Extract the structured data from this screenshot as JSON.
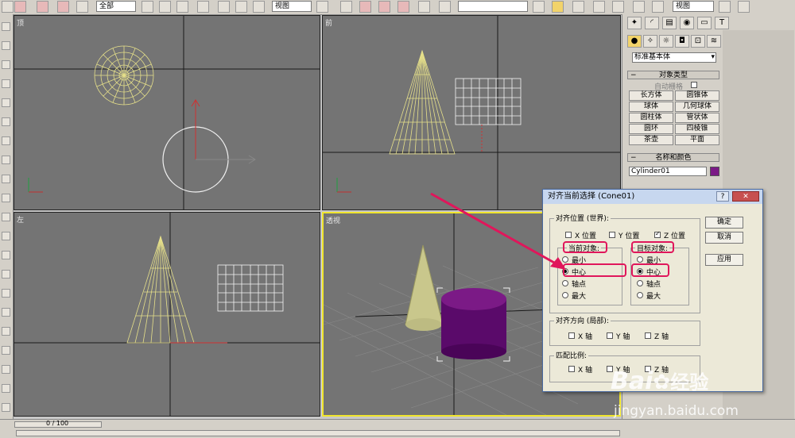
{
  "toolbar": {
    "selection_filter": "全部",
    "coord_system_1": "视图",
    "named_selection": "",
    "coord_system_2": "视图"
  },
  "viewports": {
    "top": "顶",
    "front": "前",
    "left": "左",
    "perspective": "透视"
  },
  "command_panel": {
    "category": "标准基本体",
    "object_type_header": "对象类型",
    "autogrid_label": "自动栅格",
    "buttons": [
      "长方体",
      "圆锥体",
      "球体",
      "几何球体",
      "圆柱体",
      "管状体",
      "圆环",
      "四棱锥",
      "茶壶",
      "平面"
    ],
    "name_color_header": "名称和颜色",
    "object_name": "Cylinder01",
    "object_color": "#7b1a86"
  },
  "timeline": {
    "frame_display": "0 / 100"
  },
  "dialog": {
    "title": "对齐当前选择 (Cone01)",
    "help_button": "?",
    "close_button": "✕",
    "align_position_group": "对齐位置 (世界):",
    "x_position": "X 位置",
    "y_position": "Y 位置",
    "z_position": "Z 位置",
    "x_checked": false,
    "y_checked": false,
    "z_checked": true,
    "current_object_group": "当前对象:",
    "target_object_group": "目标对象:",
    "options": [
      "最小",
      "中心",
      "轴点",
      "最大"
    ],
    "current_selected": "中心",
    "target_selected": "中心",
    "align_orientation_group": "对齐方向 (局部):",
    "orient_x": "X 轴",
    "orient_y": "Y 轴",
    "orient_z": "Z 轴",
    "match_scale_group": "匹配比例:",
    "scale_x": "X 轴",
    "scale_y": "Y 轴",
    "scale_z": "Z 轴",
    "ok_button": "确定",
    "cancel_button": "取消",
    "apply_button": "应用"
  },
  "watermark": {
    "brand": "Bai",
    "brand_suffix": "经验",
    "url": "jingyan.baidu.com"
  },
  "colors": {
    "highlight": "#e0165b",
    "wireframe": "#e6e08a",
    "active_viewport": "#f0e52d",
    "cylinder": "#6b0f7a"
  }
}
